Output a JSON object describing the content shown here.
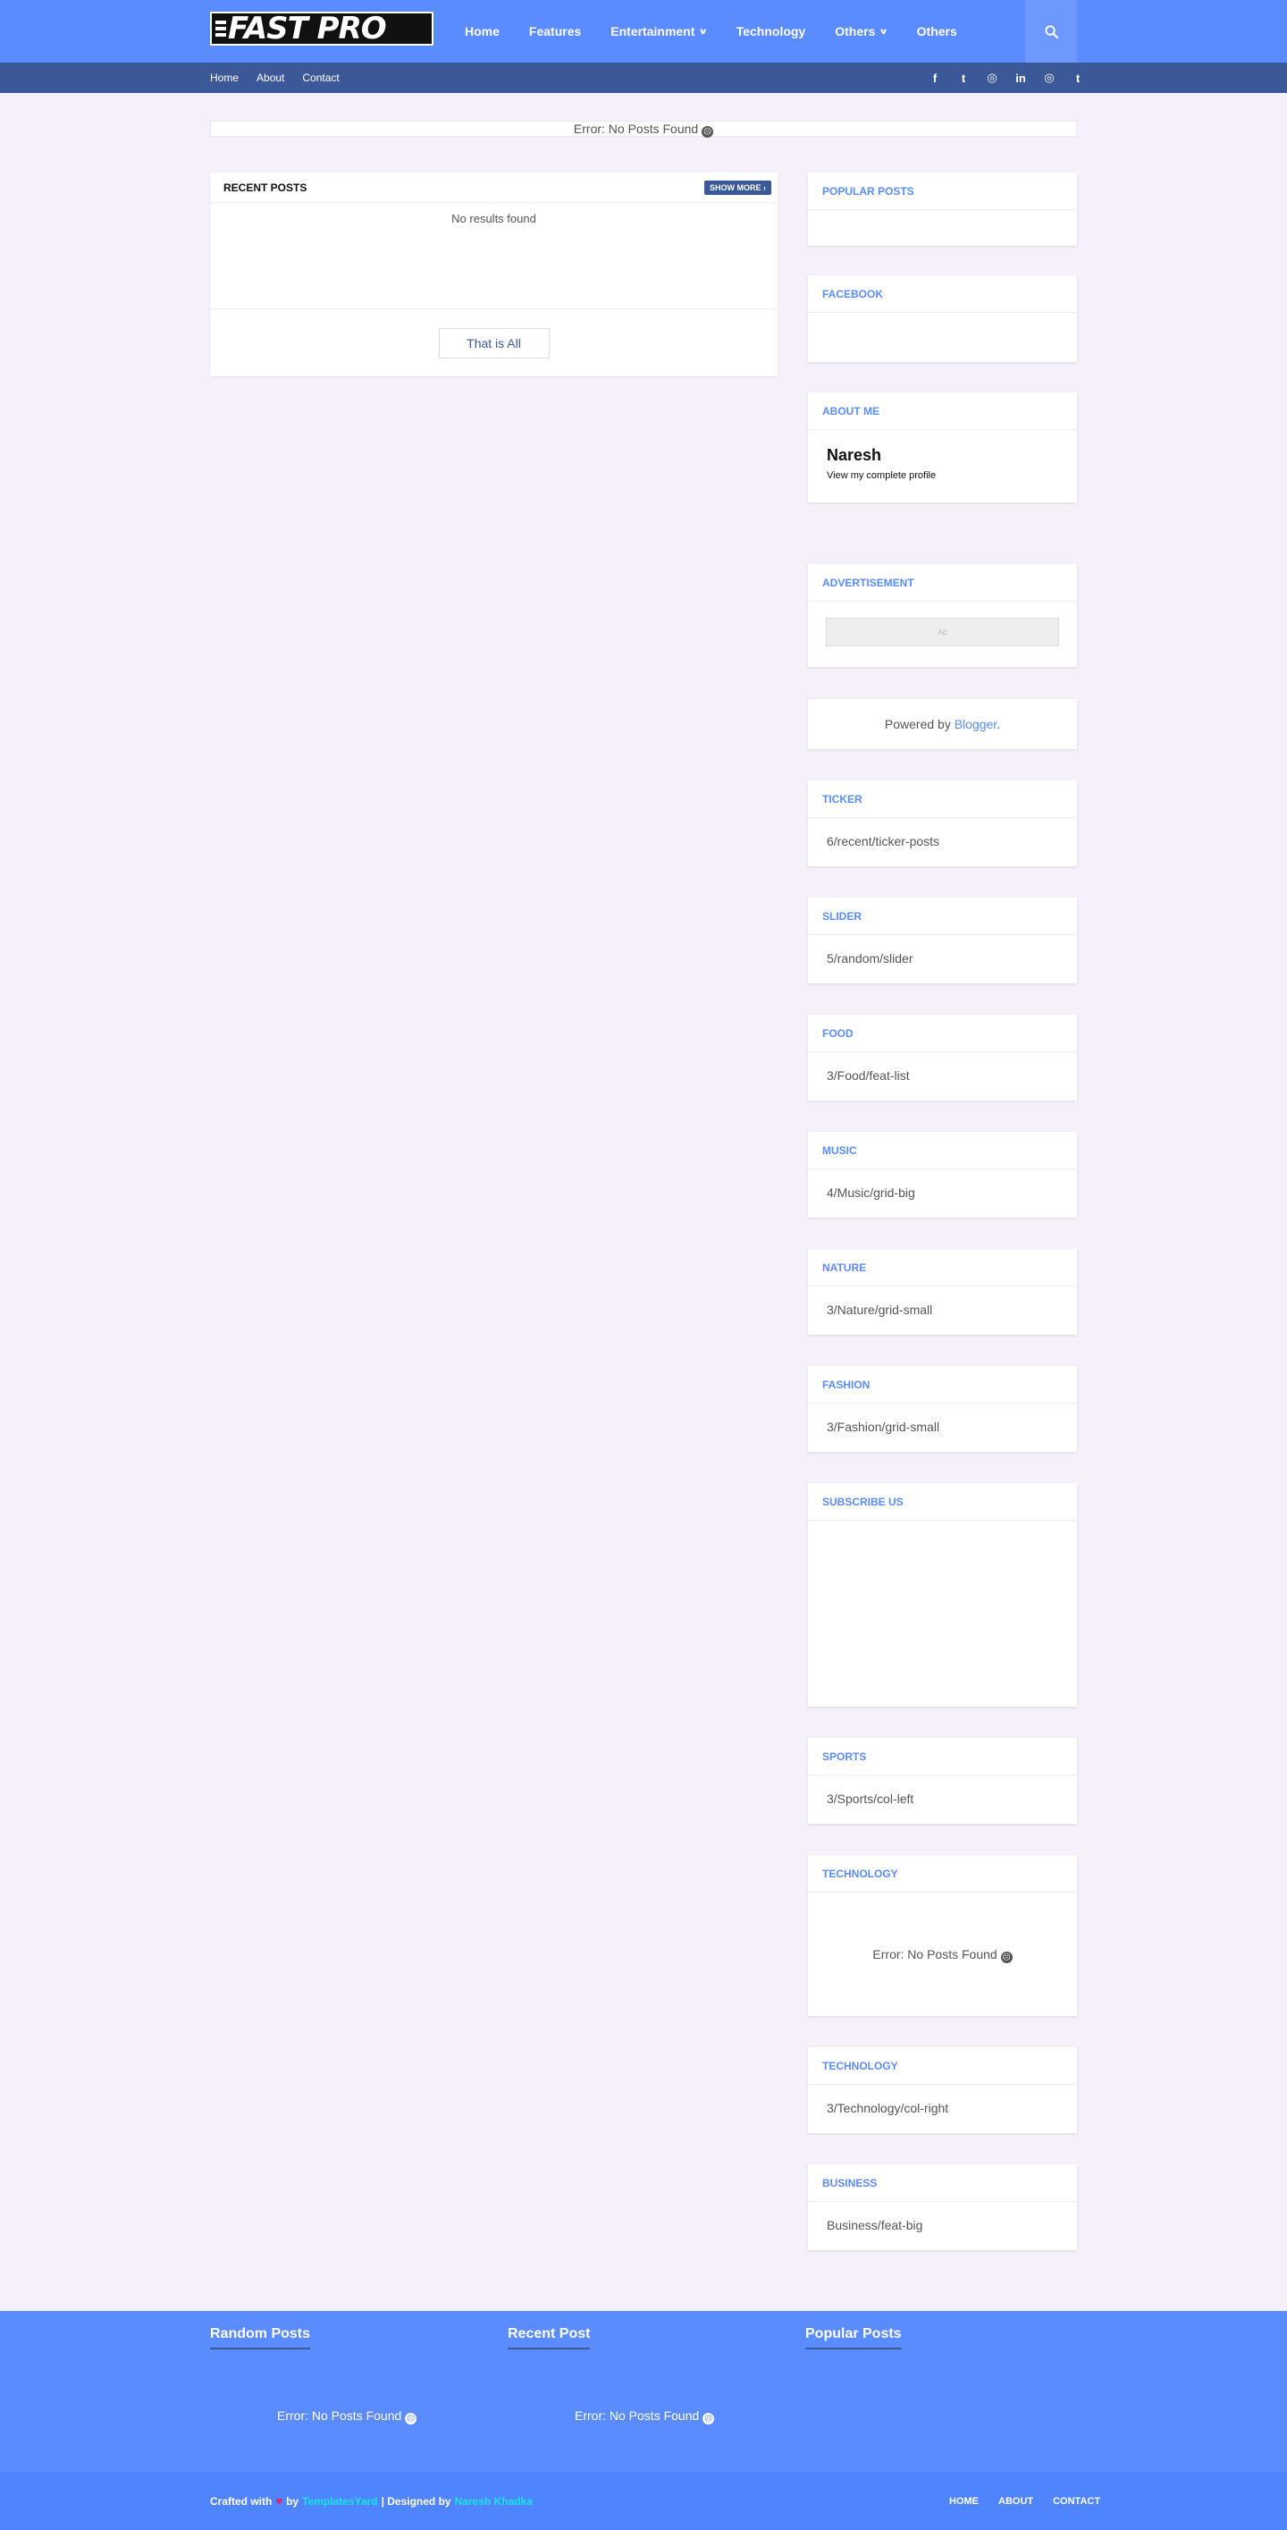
{
  "header": {
    "logo_text": "FAST PRO",
    "nav": [
      "Home",
      "Features",
      "Entertainment",
      "Technology",
      "Others",
      "Others"
    ],
    "nav_dropdown": [
      false,
      false,
      true,
      false,
      true,
      false
    ],
    "search_icon": "search-icon"
  },
  "topbar": {
    "links": [
      "Home",
      "About",
      "Contact"
    ],
    "social": [
      {
        "name": "facebook-icon",
        "glyph": "f"
      },
      {
        "name": "twitter-icon",
        "glyph": "t"
      },
      {
        "name": "instagram-icon",
        "glyph": "◎"
      },
      {
        "name": "linkedin-icon",
        "glyph": "in"
      },
      {
        "name": "instagram-icon-2",
        "glyph": "◎"
      },
      {
        "name": "tumblr-icon",
        "glyph": "t"
      }
    ]
  },
  "ticker": {
    "text": "Error: No Posts Found",
    "emoji": "☹"
  },
  "main": {
    "title": "RECENT POSTS",
    "show_more": "SHOW MORE ›",
    "no_results": "No results found",
    "that_all": "That is All"
  },
  "sidebar": {
    "popular": {
      "title": "POPULAR POSTS"
    },
    "facebook": {
      "title": "FACEBOOK"
    },
    "about": {
      "title": "ABOUT ME",
      "name": "Naresh",
      "link": "View my complete profile"
    },
    "ad": {
      "title": "ADVERTISEMENT",
      "label": "Ad"
    },
    "powered": {
      "prefix": "Powered by ",
      "link": "Blogger",
      "suffix": "."
    },
    "ticker": {
      "title": "TICKER",
      "body": "6/recent/ticker-posts"
    },
    "slider": {
      "title": "SLIDER",
      "body": "5/random/slider"
    },
    "food": {
      "title": "FOOD",
      "body": "3/Food/feat-list"
    },
    "music": {
      "title": "MUSIC",
      "body": "4/Music/grid-big"
    },
    "nature": {
      "title": "NATURE",
      "body": "3/Nature/grid-small"
    },
    "fashion": {
      "title": "FASHION",
      "body": "3/Fashion/grid-small"
    },
    "subscribe": {
      "title": "SUBSCRIBE US"
    },
    "sports": {
      "title": "SPORTS",
      "body": "3/Sports/col-left"
    },
    "technology1": {
      "title": "TECHNOLOGY",
      "error": "Error: No Posts Found"
    },
    "technology2": {
      "title": "TECHNOLOGY",
      "body": "3/Technology/col-right"
    },
    "business": {
      "title": "BUSINESS",
      "body": "Business/feat-big"
    }
  },
  "footer": {
    "random": {
      "title": "Random Posts",
      "error": "Error: No Posts Found"
    },
    "recent": {
      "title": "Recent Post",
      "error": "Error: No Posts Found"
    },
    "popular": {
      "title": "Popular Posts"
    },
    "credits": {
      "crafted": "Crafted with",
      "by": "by",
      "author": "TemplatesYard",
      "designed": "| Designed by",
      "designer": "Naresh Khadka"
    },
    "links": [
      "HOME",
      "ABOUT",
      "CONTACT"
    ]
  },
  "colors": {
    "accent": "#5b8cff",
    "dark_accent": "#3b5998",
    "background": "#f5f0fa",
    "heart": "#e0245e",
    "credit_link": "#19e3e3"
  }
}
